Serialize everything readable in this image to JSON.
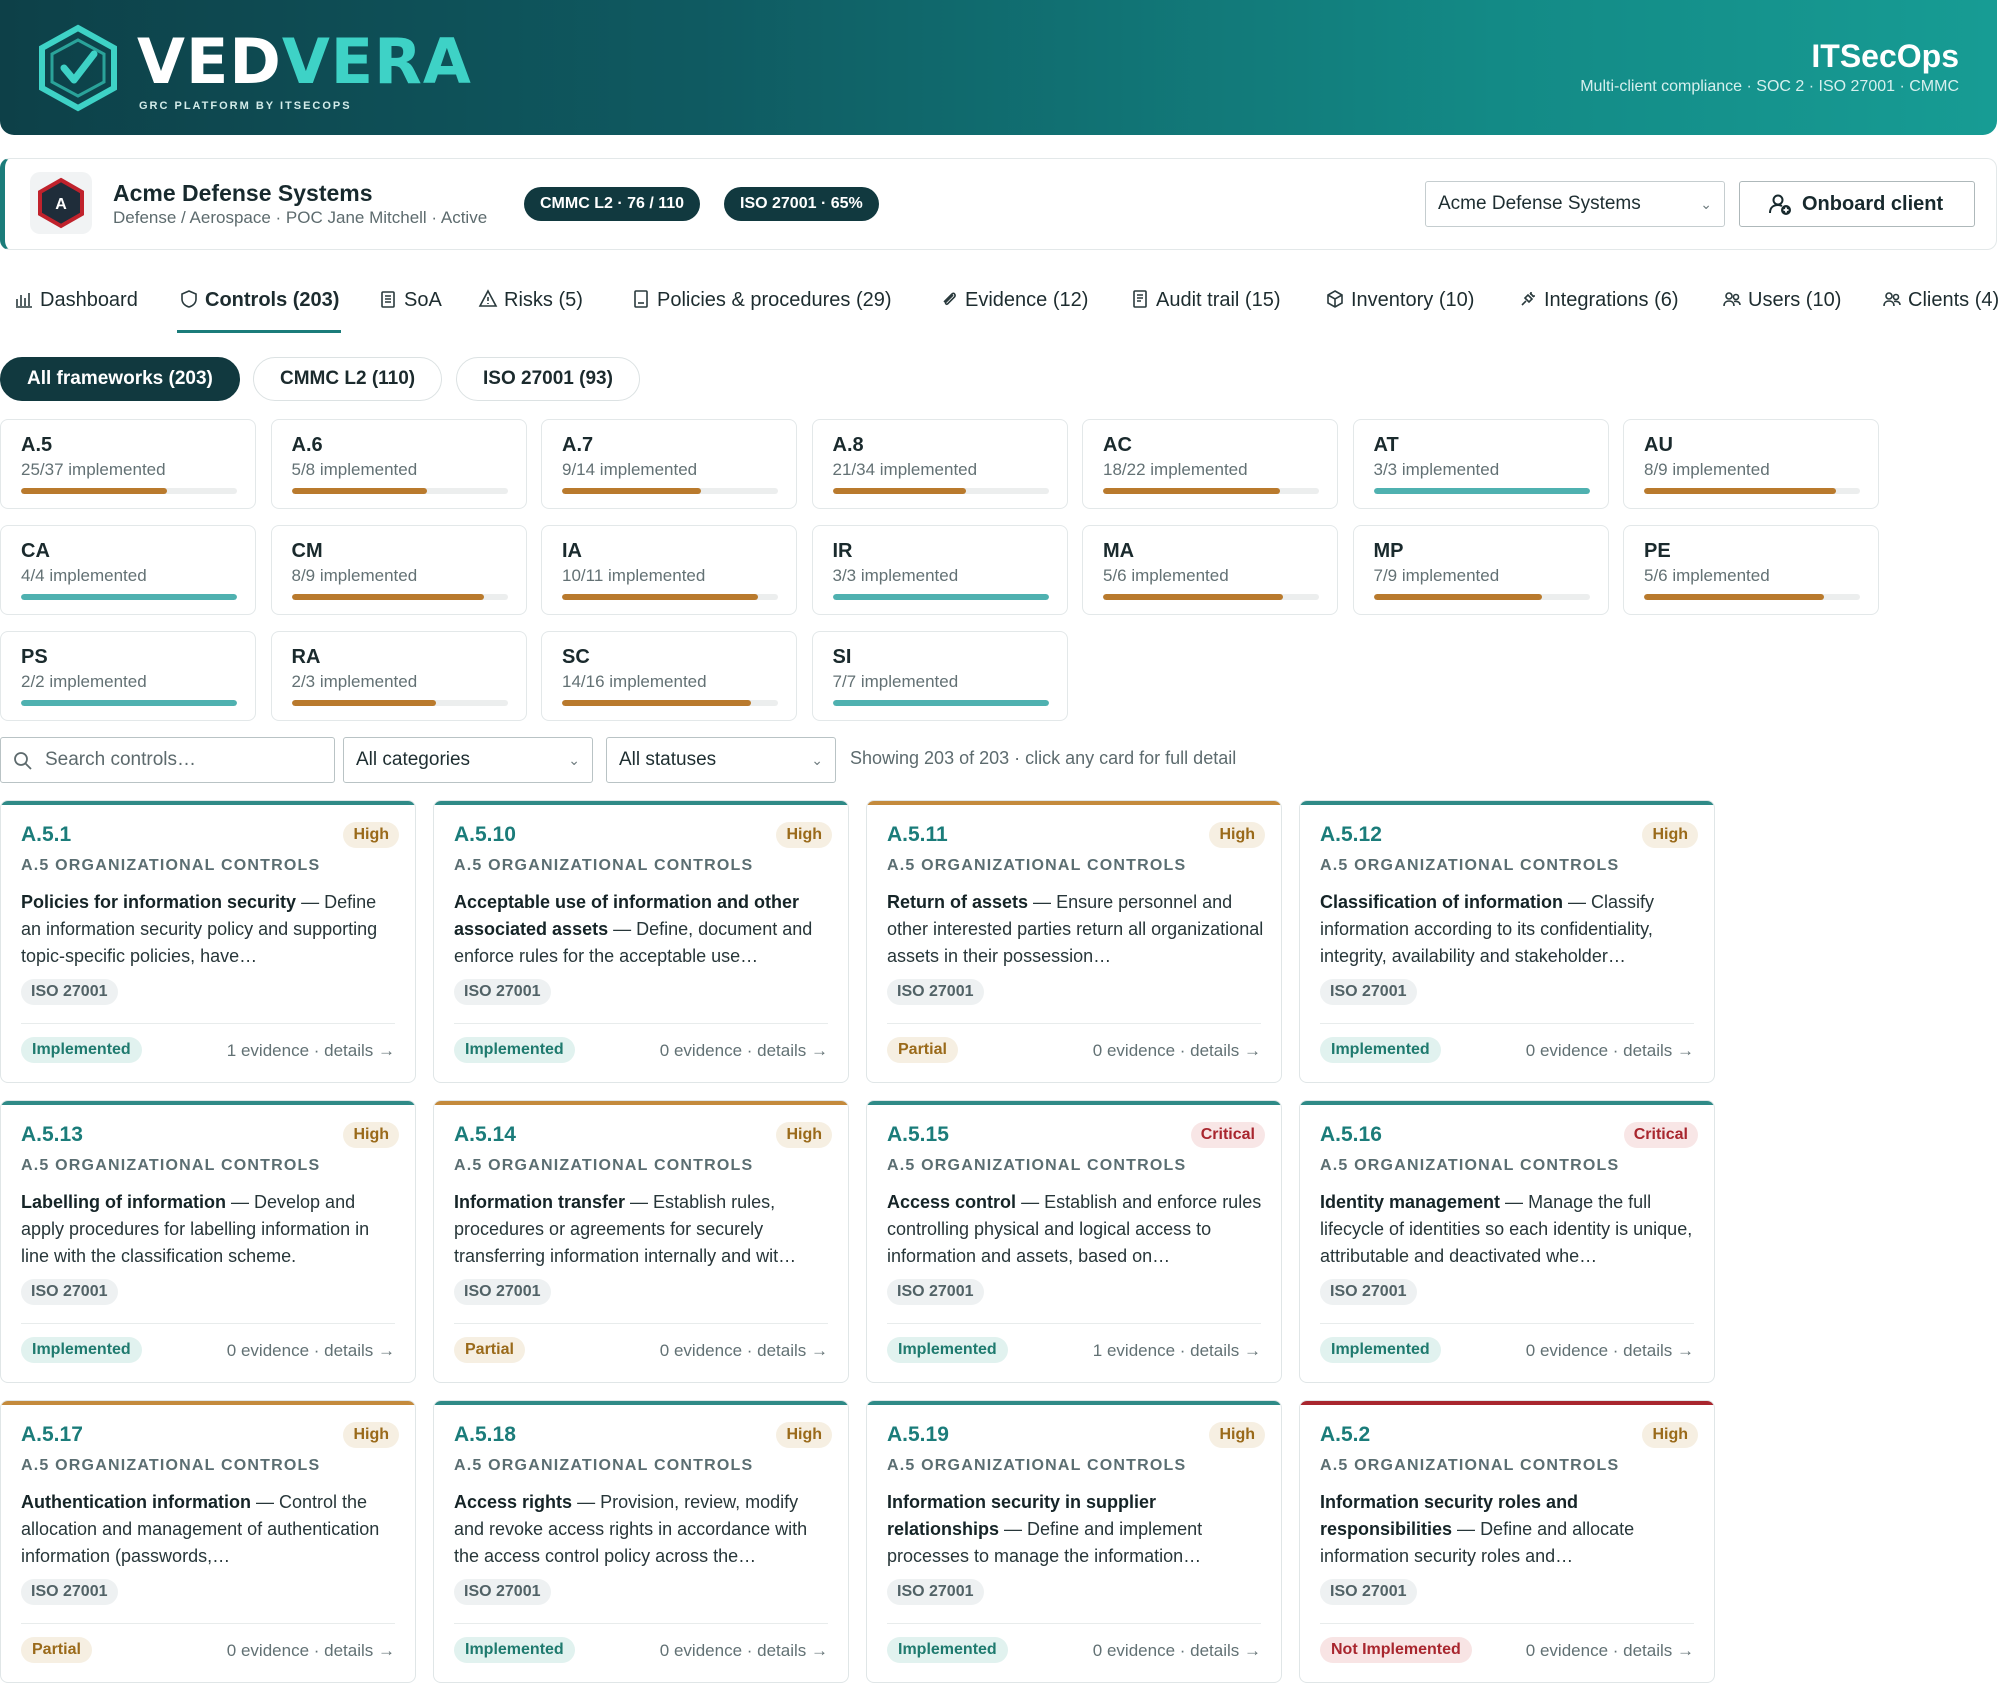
{
  "header": {
    "logo_part1": "VED",
    "logo_part2": "VERA",
    "logo_tagline": "GRC PLATFORM BY ITSECOPS",
    "brand": "ITSecOps",
    "brand_subtitle": "Multi-client compliance · SOC 2 · ISO 27001 · CMMC",
    "colors": {
      "accent": "#1b7c7a",
      "brand_light": "#3ed2c6",
      "dark": "#11393f"
    }
  },
  "client": {
    "name": "Acme Defense Systems",
    "meta": "Defense / Aerospace · POC Jane Mitchell · Active",
    "logo_letter": "A",
    "badge_cmmc": "CMMC L2 · 76 / 110",
    "badge_iso": "ISO 27001 · 65%",
    "selector_value": "Acme Defense Systems",
    "onboard_label": "Onboard client"
  },
  "tabs": [
    {
      "label": "Dashboard",
      "icon": "bar-chart-icon"
    },
    {
      "label": "Controls (203)",
      "icon": "shield-icon",
      "active": true
    },
    {
      "label": "SoA",
      "icon": "clipboard-icon"
    },
    {
      "label": "Risks (5)",
      "icon": "warning-icon"
    },
    {
      "label": "Policies & procedures (29)",
      "icon": "document-icon"
    },
    {
      "label": "Evidence (12)",
      "icon": "paperclip-icon"
    },
    {
      "label": "Audit trail (15)",
      "icon": "audit-file-icon"
    },
    {
      "label": "Inventory (10)",
      "icon": "package-icon"
    },
    {
      "label": "Integrations (6)",
      "icon": "plug-icon"
    },
    {
      "label": "Users (10)",
      "icon": "users-icon"
    },
    {
      "label": "Clients (4)",
      "icon": "users-icon"
    }
  ],
  "frameworks": [
    {
      "label": "All frameworks (203)",
      "active": true
    },
    {
      "label": "CMMC L2 (110)"
    },
    {
      "label": "ISO 27001 (93)"
    }
  ],
  "families": [
    {
      "code": "A.5",
      "count": "25/37 implemented",
      "ratio": 0.676
    },
    {
      "code": "A.6",
      "count": "5/8 implemented",
      "ratio": 0.625
    },
    {
      "code": "A.7",
      "count": "9/14 implemented",
      "ratio": 0.643
    },
    {
      "code": "A.8",
      "count": "21/34 implemented",
      "ratio": 0.618
    },
    {
      "code": "AC",
      "count": "18/22 implemented",
      "ratio": 0.818
    },
    {
      "code": "AT",
      "count": "3/3 implemented",
      "ratio": 1.0
    },
    {
      "code": "AU",
      "count": "8/9 implemented",
      "ratio": 0.889
    },
    {
      "code": "CA",
      "count": "4/4 implemented",
      "ratio": 1.0
    },
    {
      "code": "CM",
      "count": "8/9 implemented",
      "ratio": 0.889
    },
    {
      "code": "IA",
      "count": "10/11 implemented",
      "ratio": 0.909
    },
    {
      "code": "IR",
      "count": "3/3 implemented",
      "ratio": 1.0
    },
    {
      "code": "MA",
      "count": "5/6 implemented",
      "ratio": 0.833
    },
    {
      "code": "MP",
      "count": "7/9 implemented",
      "ratio": 0.778
    },
    {
      "code": "PE",
      "count": "5/6 implemented",
      "ratio": 0.833
    },
    {
      "code": "PS",
      "count": "2/2 implemented",
      "ratio": 1.0
    },
    {
      "code": "RA",
      "count": "2/3 implemented",
      "ratio": 0.667
    },
    {
      "code": "SC",
      "count": "14/16 implemented",
      "ratio": 0.875
    },
    {
      "code": "SI",
      "count": "7/7 implemented",
      "ratio": 1.0
    }
  ],
  "progress_colors": {
    "complete": "#4fb1b0",
    "partial": "#b97a2d"
  },
  "toolbar": {
    "search_placeholder": "Search controls…",
    "category_value": "All categories",
    "status_value": "All statuses",
    "showing": "Showing 203 of 203 · click any card for full detail"
  },
  "controls": [
    {
      "id": "A.5.1",
      "severity": "High",
      "category": "A.5 ORGANIZATIONAL CONTROLS",
      "title": "Policies for information security",
      "desc": "Define an information security policy and supporting topic-specific policies, have…",
      "framework": "ISO 27001",
      "status": "Implemented",
      "evidence": "1 evidence · details →"
    },
    {
      "id": "A.5.10",
      "severity": "High",
      "category": "A.5 ORGANIZATIONAL CONTROLS",
      "title": "Acceptable use of information and other associated assets",
      "desc": "Define, document and enforce rules for the acceptable use…",
      "framework": "ISO 27001",
      "status": "Implemented",
      "evidence": "0 evidence · details →"
    },
    {
      "id": "A.5.11",
      "severity": "High",
      "category": "A.5 ORGANIZATIONAL CONTROLS",
      "title": "Return of assets",
      "desc": "Ensure personnel and other interested parties return all organizational assets in their possession…",
      "framework": "ISO 27001",
      "status": "Partial",
      "evidence": "0 evidence · details →"
    },
    {
      "id": "A.5.12",
      "severity": "High",
      "category": "A.5 ORGANIZATIONAL CONTROLS",
      "title": "Classification of information",
      "desc": "Classify information according to its confidentiality, integrity, availability and stakeholder…",
      "framework": "ISO 27001",
      "status": "Implemented",
      "evidence": "0 evidence · details →"
    },
    {
      "id": "A.5.13",
      "severity": "High",
      "category": "A.5 ORGANIZATIONAL CONTROLS",
      "title": "Labelling of information",
      "desc": "Develop and apply procedures for labelling information in line with the classification scheme.",
      "framework": "ISO 27001",
      "status": "Implemented",
      "evidence": "0 evidence · details →"
    },
    {
      "id": "A.5.14",
      "severity": "High",
      "category": "A.5 ORGANIZATIONAL CONTROLS",
      "title": "Information transfer",
      "desc": "Establish rules, procedures or agreements for securely transferring information internally and wit…",
      "framework": "ISO 27001",
      "status": "Partial",
      "evidence": "0 evidence · details →"
    },
    {
      "id": "A.5.15",
      "severity": "Critical",
      "category": "A.5 ORGANIZATIONAL CONTROLS",
      "title": "Access control",
      "desc": "Establish and enforce rules controlling physical and logical access to information and assets, based on…",
      "framework": "ISO 27001",
      "status": "Implemented",
      "evidence": "1 evidence · details →"
    },
    {
      "id": "A.5.16",
      "severity": "Critical",
      "category": "A.5 ORGANIZATIONAL CONTROLS",
      "title": "Identity management",
      "desc": "Manage the full lifecycle of identities so each identity is unique, attributable and deactivated whe…",
      "framework": "ISO 27001",
      "status": "Implemented",
      "evidence": "0 evidence · details →"
    },
    {
      "id": "A.5.17",
      "severity": "High",
      "category": "A.5 ORGANIZATIONAL CONTROLS",
      "title": "Authentication information",
      "desc": "Control the allocation and management of authentication information (passwords,…",
      "framework": "ISO 27001",
      "status": "Partial",
      "evidence": "0 evidence · details →"
    },
    {
      "id": "A.5.18",
      "severity": "High",
      "category": "A.5 ORGANIZATIONAL CONTROLS",
      "title": "Access rights",
      "desc": "Provision, review, modify and revoke access rights in accordance with the access control policy across the…",
      "framework": "ISO 27001",
      "status": "Implemented",
      "evidence": "0 evidence · details →"
    },
    {
      "id": "A.5.19",
      "severity": "High",
      "category": "A.5 ORGANIZATIONAL CONTROLS",
      "title": "Information security in supplier relationships",
      "desc": "Define and implement processes to manage the information…",
      "framework": "ISO 27001",
      "status": "Implemented",
      "evidence": "0 evidence · details →"
    },
    {
      "id": "A.5.2",
      "severity": "High",
      "category": "A.5 ORGANIZATIONAL CONTROLS",
      "title": "Information security roles and responsibilities",
      "desc": "Define and allocate information security roles and…",
      "framework": "ISO 27001",
      "status": "Not Implemented",
      "evidence": "0 evidence · details →"
    }
  ],
  "status_topline_colors": {
    "Implemented": "#2f8a87",
    "Partial": "#c48a3c",
    "Not Implemented": "#a8262e"
  }
}
